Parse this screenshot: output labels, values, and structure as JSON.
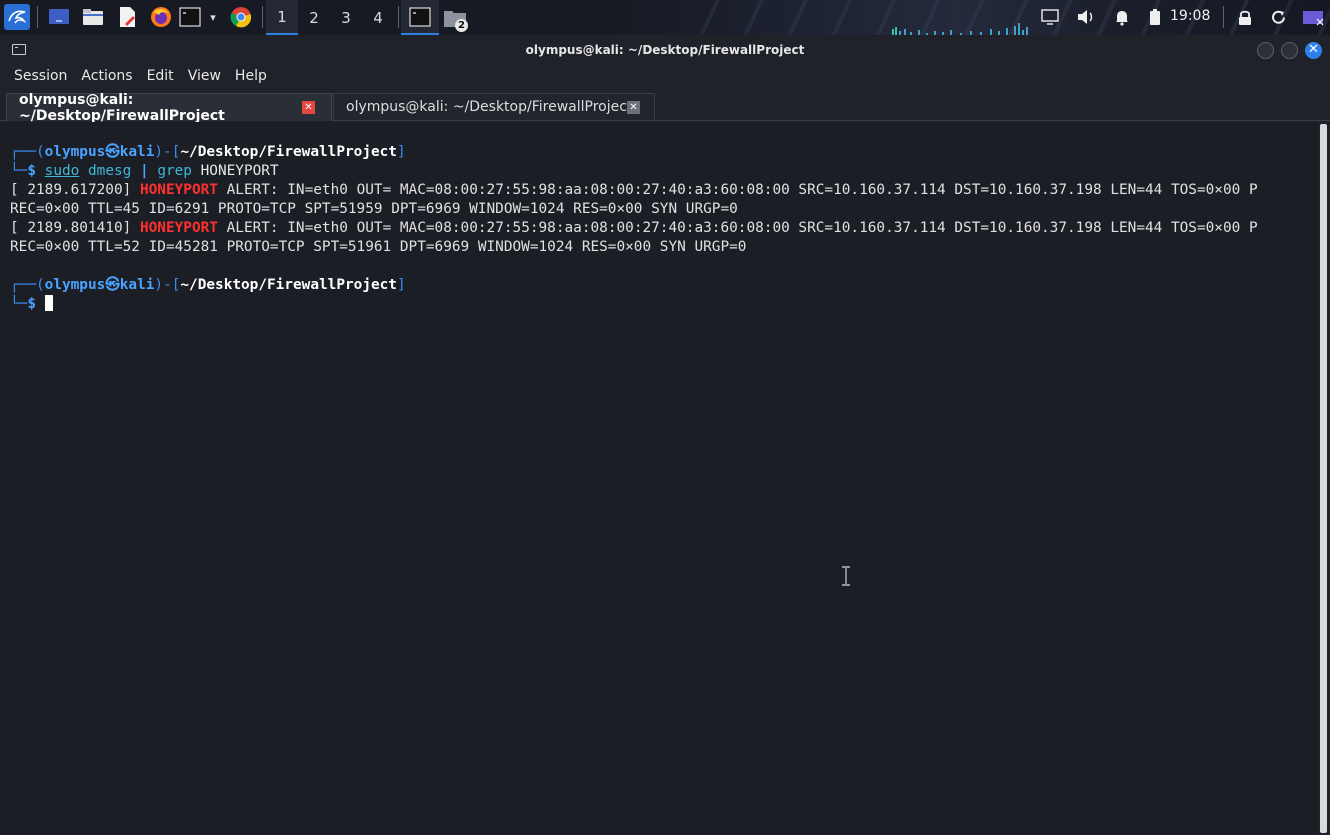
{
  "taskbar": {
    "workspaces": [
      "1",
      "2",
      "3",
      "4"
    ],
    "active_workspace": "1",
    "files_badge": "2",
    "clock": "19:08"
  },
  "window": {
    "title": "olympus@kali: ~/Desktop/FirewallProject",
    "menu": [
      "Session",
      "Actions",
      "Edit",
      "View",
      "Help"
    ],
    "tabs": [
      {
        "label": "olympus@kali: ~/Desktop/FirewallProject",
        "active": true
      },
      {
        "label": "olympus@kali: ~/Desktop/FirewallProject",
        "active": false
      }
    ]
  },
  "terminal": {
    "prompt1": {
      "corner": "┌──(",
      "user": "olympus",
      "at": "㉿",
      "host": "kali",
      "mid": ")-[",
      "path": "~/Desktop/FirewallProject",
      "close": "]"
    },
    "command1": {
      "corner": "└─",
      "dollar": "$",
      "sudo": "sudo",
      "rest": " dmesg ",
      "pipe": "|",
      "grep": " grep",
      "arg": " HONEYPORT"
    },
    "output": [
      {
        "ts": "[ 2189.617200] ",
        "tag": "HONEYPORT",
        "rest": " ALERT: IN=eth0 OUT= MAC=08:00:27:55:98:aa:08:00:27:40:a3:60:08:00 SRC=10.160.37.114 DST=10.160.37.198 LEN=44 TOS=0×00 P",
        "wrap": "REC=0×00 TTL=45 ID=6291 PROTO=TCP SPT=51959 DPT=6969 WINDOW=1024 RES=0×00 SYN URGP=0"
      },
      {
        "ts": "[ 2189.801410] ",
        "tag": "HONEYPORT",
        "rest": " ALERT: IN=eth0 OUT= MAC=08:00:27:55:98:aa:08:00:27:40:a3:60:08:00 SRC=10.160.37.114 DST=10.160.37.198 LEN=44 TOS=0×00 P",
        "wrap": "REC=0×00 TTL=52 ID=45281 PROTO=TCP SPT=51961 DPT=6969 WINDOW=1024 RES=0×00 SYN URGP=0"
      }
    ],
    "prompt2": {
      "corner": "┌──(",
      "user": "olympus",
      "at": "㉿",
      "host": "kali",
      "mid": ")-[",
      "path": "~/Desktop/FirewallProject",
      "close": "]"
    },
    "command2": {
      "corner": "└─",
      "dollar": "$"
    }
  },
  "colors": {
    "accent": "#2f7fe0",
    "prompt_blue": "#4aa3ff",
    "alert_red": "#ff3030",
    "terminal_bg": "#1b1e25"
  },
  "icons": [
    "kali-menu-icon",
    "desktop-icon",
    "file-manager-icon",
    "text-editor-icon",
    "firefox-icon",
    "terminal-icon",
    "chrome-icon",
    "terminal-task-icon",
    "files-task-icon",
    "display-icon",
    "volume-icon",
    "notification-bell-icon",
    "battery-icon",
    "lock-icon",
    "refresh-icon",
    "logout-icon"
  ]
}
